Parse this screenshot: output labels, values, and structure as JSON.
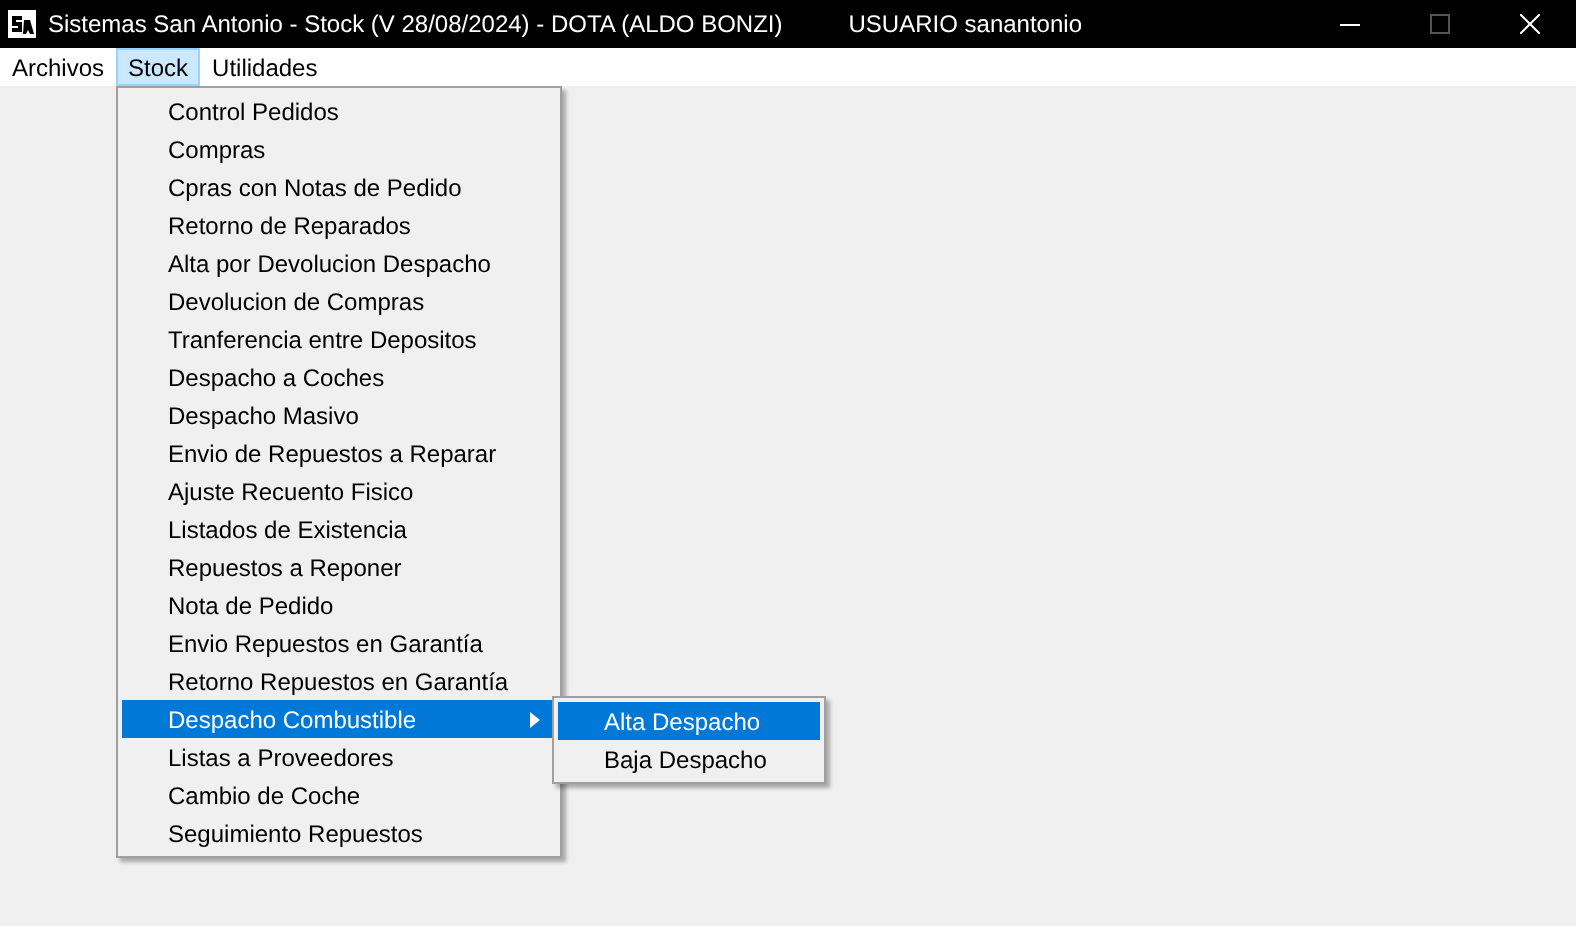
{
  "window": {
    "title": "Sistemas San Antonio - Stock (V 28/08/2024) - DOTA (ALDO BONZI)",
    "user": "USUARIO sanantonio"
  },
  "menu_bar": [
    {
      "label": "Archivos",
      "selected": false
    },
    {
      "label": "Stock",
      "selected": true
    },
    {
      "label": "Utilidades",
      "selected": false
    }
  ],
  "dropdown": [
    {
      "label": "Control Pedidos",
      "selected": false,
      "submenu": false
    },
    {
      "label": "Compras",
      "selected": false,
      "submenu": false
    },
    {
      "label": "Cpras con Notas de Pedido",
      "selected": false,
      "submenu": false
    },
    {
      "label": "Retorno de Reparados",
      "selected": false,
      "submenu": false
    },
    {
      "label": "Alta por Devolucion Despacho",
      "selected": false,
      "submenu": false
    },
    {
      "label": "Devolucion de Compras",
      "selected": false,
      "submenu": false
    },
    {
      "label": "Tranferencia entre Depositos",
      "selected": false,
      "submenu": false
    },
    {
      "label": "Despacho a Coches",
      "selected": false,
      "submenu": false
    },
    {
      "label": "Despacho Masivo",
      "selected": false,
      "submenu": false
    },
    {
      "label": "Envio de Repuestos a Reparar",
      "selected": false,
      "submenu": false
    },
    {
      "label": "Ajuste Recuento Fisico",
      "selected": false,
      "submenu": false
    },
    {
      "label": "Listados de Existencia",
      "selected": false,
      "submenu": false
    },
    {
      "label": "Repuestos a Reponer",
      "selected": false,
      "submenu": false
    },
    {
      "label": "Nota de Pedido",
      "selected": false,
      "submenu": false
    },
    {
      "label": "Envio Repuestos en Garantía",
      "selected": false,
      "submenu": false
    },
    {
      "label": "Retorno Repuestos en Garantía",
      "selected": false,
      "submenu": false
    },
    {
      "label": "Despacho Combustible",
      "selected": true,
      "submenu": true
    },
    {
      "label": "Listas a Proveedores",
      "selected": false,
      "submenu": false
    },
    {
      "label": "Cambio de Coche",
      "selected": false,
      "submenu": false
    },
    {
      "label": "Seguimiento Repuestos",
      "selected": false,
      "submenu": false
    }
  ],
  "submenu": [
    {
      "label": "Alta Despacho",
      "selected": true
    },
    {
      "label": "Baja Despacho",
      "selected": false
    }
  ]
}
